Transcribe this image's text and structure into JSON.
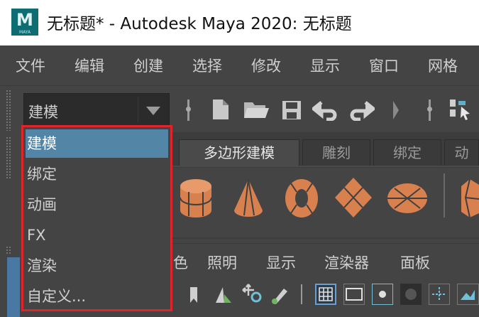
{
  "window": {
    "title": "无标题* - Autodesk Maya 2020: 无标题",
    "logo_letter": "M",
    "logo_sub": "MAYA"
  },
  "menubar": {
    "items": [
      "文件",
      "编辑",
      "创建",
      "选择",
      "修改",
      "显示",
      "窗口",
      "网格"
    ]
  },
  "toolbar": {
    "mode_select_value": "建模",
    "icons": [
      "new-scene-icon",
      "open-scene-icon",
      "save-scene-icon",
      "undo-icon",
      "redo-icon",
      "select-tool-icon"
    ]
  },
  "dropdown": {
    "options": [
      "建模",
      "绑定",
      "动画",
      "FX",
      "渲染",
      "自定义..."
    ],
    "selected": "建模"
  },
  "shelf": {
    "tabs": [
      "多边形建模",
      "雕刻",
      "绑定",
      "动"
    ],
    "active_tab": "多边形建模",
    "icons": [
      "poly-cylinder-icon",
      "poly-cone-icon",
      "poly-torus-icon",
      "poly-plane-icon",
      "poly-disc-icon",
      "poly-platonic-icon"
    ]
  },
  "panel_menu": {
    "items": [
      "色",
      "照明",
      "显示",
      "渲染器",
      "面板"
    ]
  },
  "colors": {
    "accent_highlight": "#5285a6",
    "annotation_border": "#e0242b",
    "shelf_icon": "#d9804f"
  }
}
